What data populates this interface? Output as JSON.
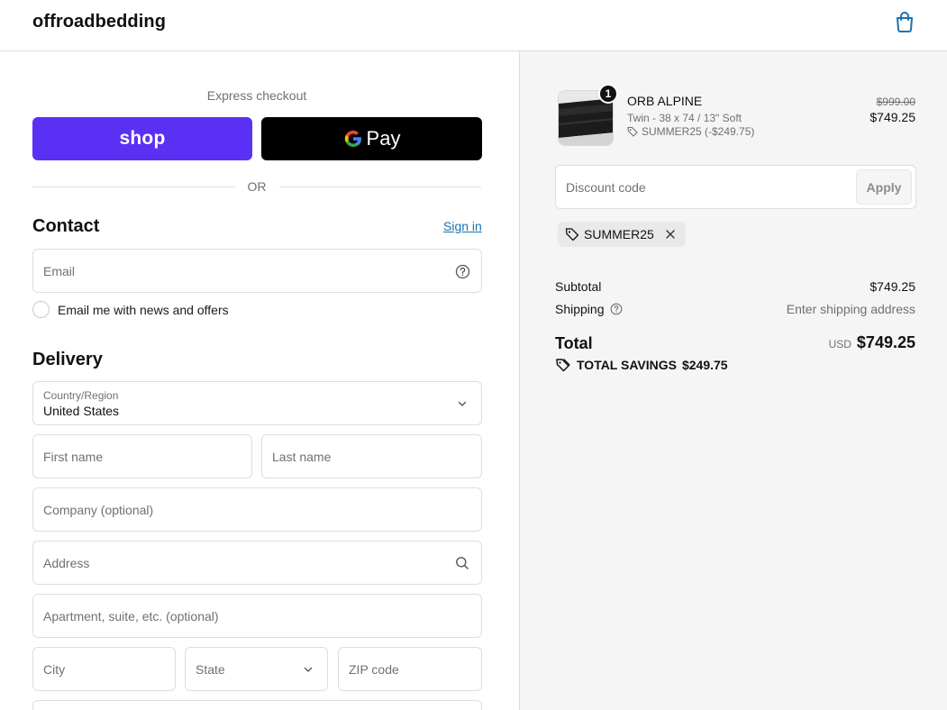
{
  "header": {
    "brand": "offroadbedding"
  },
  "express": {
    "label": "Express checkout",
    "shop_label": "shop",
    "gpay_g": "G",
    "gpay_label": "Pay",
    "or_label": "OR"
  },
  "contact": {
    "title": "Contact",
    "signin_label": "Sign in",
    "email_placeholder": "Email",
    "newsletter_label": "Email me with news and offers"
  },
  "delivery": {
    "title": "Delivery",
    "country_label": "Country/Region",
    "country_value": "United States",
    "first_name": "First name",
    "last_name": "Last name",
    "company": "Company (optional)",
    "address": "Address",
    "apartment": "Apartment, suite, etc. (optional)",
    "city": "City",
    "state": "State",
    "zip": "ZIP code"
  },
  "cart": {
    "quantity": "1",
    "product_name": "ORB ALPINE",
    "variant": "Twin - 38 x 74 / 13\" Soft",
    "line_discount": "SUMMER25 (-$249.75)",
    "old_price": "$999.00",
    "price": "$749.25"
  },
  "discount": {
    "placeholder": "Discount code",
    "apply_label": "Apply",
    "applied_code": "SUMMER25"
  },
  "summary": {
    "subtotal_label": "Subtotal",
    "subtotal_value": "$749.25",
    "shipping_label": "Shipping",
    "shipping_value": "Enter shipping address",
    "total_label": "Total",
    "currency": "USD",
    "total_value": "$749.25",
    "savings_label": "TOTAL SAVINGS",
    "savings_value": "$249.75"
  },
  "colors": {
    "shop_purple": "#5a31f4",
    "link_blue": "#1773b0",
    "summary_bg": "#f5f5f5"
  }
}
